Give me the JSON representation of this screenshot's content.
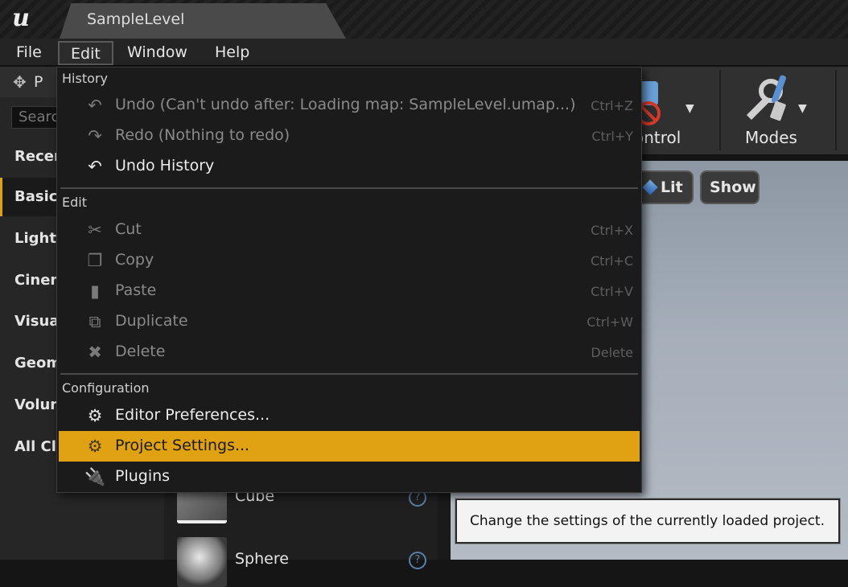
{
  "titlebar": {
    "tab_label": "SampleLevel"
  },
  "menubar": {
    "items": [
      {
        "label": "File"
      },
      {
        "label": "Edit"
      },
      {
        "label": "Window"
      },
      {
        "label": "Help"
      }
    ]
  },
  "left_panel": {
    "tab_label": "P",
    "search_placeholder": "Searc",
    "categories": [
      {
        "label": "Recer"
      },
      {
        "label": "Basic"
      },
      {
        "label": "Lights"
      },
      {
        "label": "Cinem"
      },
      {
        "label": "Visua"
      },
      {
        "label": "Geom"
      },
      {
        "label": "Volun"
      },
      {
        "label": "All Cla"
      }
    ],
    "assets": [
      {
        "label": "Cube"
      },
      {
        "label": "Sphere"
      }
    ]
  },
  "toolbar": {
    "control_label": "ontrol",
    "modes_label": "Modes"
  },
  "viewport": {
    "lit_label": "Lit",
    "show_label": "Show"
  },
  "edit_menu": {
    "sections": {
      "history": "History",
      "edit": "Edit",
      "configuration": "Configuration"
    },
    "items": {
      "undo": {
        "label": "Undo (Can't undo after: Loading map: SampleLevel.umap...)",
        "shortcut": "Ctrl+Z"
      },
      "redo": {
        "label": "Redo (Nothing to redo)",
        "shortcut": "Ctrl+Y"
      },
      "undo_history": {
        "label": "Undo History"
      },
      "cut": {
        "label": "Cut",
        "shortcut": "Ctrl+X"
      },
      "copy": {
        "label": "Copy",
        "shortcut": "Ctrl+C"
      },
      "paste": {
        "label": "Paste",
        "shortcut": "Ctrl+V"
      },
      "duplicate": {
        "label": "Duplicate",
        "shortcut": "Ctrl+W"
      },
      "delete": {
        "label": "Delete",
        "shortcut": "Delete"
      },
      "editor_preferences": {
        "label": "Editor Preferences..."
      },
      "project_settings": {
        "label": "Project Settings..."
      },
      "plugins": {
        "label": "Plugins"
      }
    }
  },
  "tooltip": {
    "text": "Change the settings of the currently loaded project."
  },
  "colors": {
    "highlight": "#e0a213",
    "selected_category_accent": "#e0a213"
  }
}
